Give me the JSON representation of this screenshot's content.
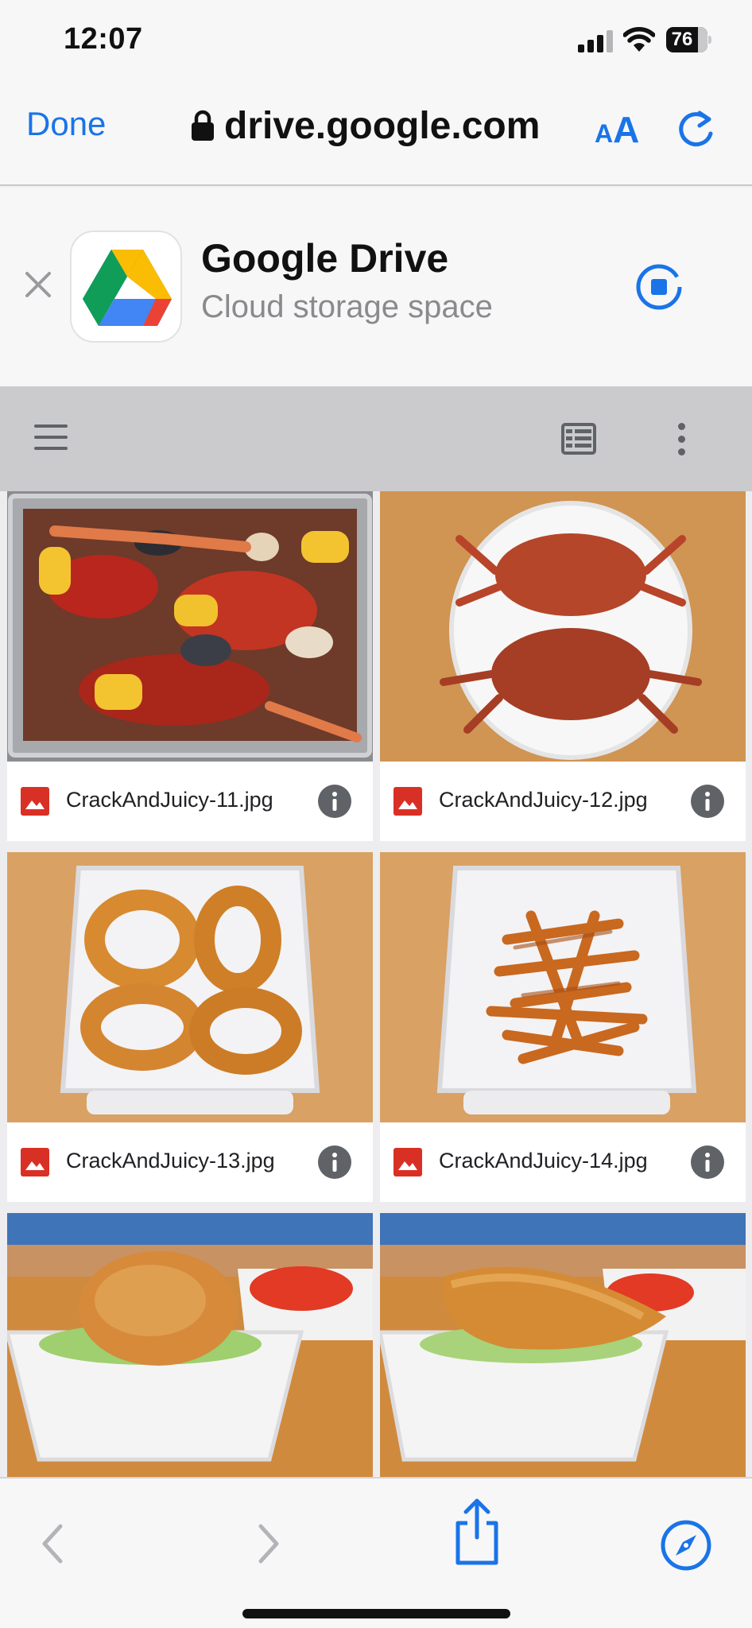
{
  "status_bar": {
    "time": "12:07",
    "battery": "76"
  },
  "browser": {
    "done_label": "Done",
    "url": "drive.google.com",
    "text_size_small": "A",
    "text_size_large": "A"
  },
  "banner": {
    "app_name": "Google Drive",
    "subtitle": "Cloud storage space"
  },
  "files": [
    {
      "name": "CrackAndJuicy-11.jpg",
      "thumbnail": "seafood-boil"
    },
    {
      "name": "CrackAndJuicy-12.jpg",
      "thumbnail": "blue-crabs"
    },
    {
      "name": "CrackAndJuicy-13.jpg",
      "thumbnail": "onion-rings"
    },
    {
      "name": "CrackAndJuicy-14.jpg",
      "thumbnail": "fries"
    },
    {
      "name": "",
      "thumbnail": "crab-cake-sandwich"
    },
    {
      "name": "",
      "thumbnail": "fried-fish-sandwich"
    }
  ],
  "icons": {
    "status": [
      "signal-icon",
      "wifi-icon",
      "battery-icon"
    ],
    "browser": [
      "lock-icon",
      "text-size-icon",
      "reload-icon"
    ],
    "drive_toolbar": [
      "menu-icon",
      "list-view-icon",
      "more-vert-icon"
    ],
    "file": [
      "image-file-icon",
      "info-icon"
    ],
    "bottom": [
      "back-icon",
      "forward-icon",
      "share-icon",
      "compass-icon"
    ]
  },
  "colors": {
    "accent": "#1a74e8",
    "image_file_icon": "#d93025",
    "toolbar_grey": "#5f6368"
  }
}
